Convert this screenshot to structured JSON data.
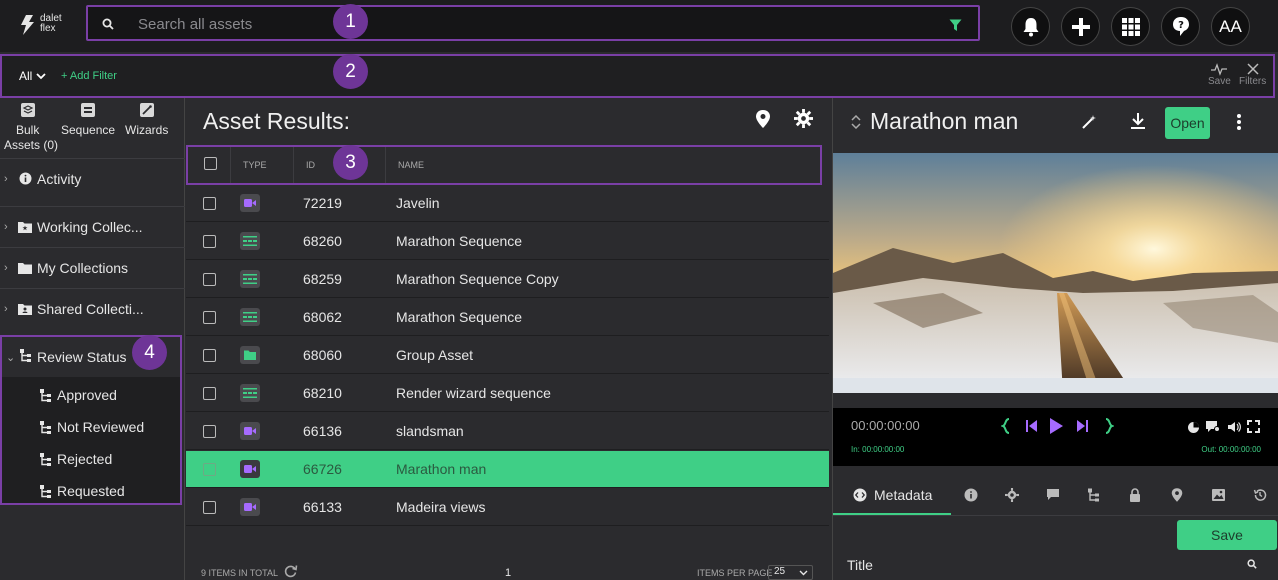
{
  "app": {
    "logo_line1": "dalet",
    "logo_line2": "flex"
  },
  "search": {
    "placeholder": "Search all assets"
  },
  "top_actions": {
    "avatar_initials": "AA"
  },
  "callouts": [
    "1",
    "2",
    "3",
    "4"
  ],
  "filterbar": {
    "scope": "All",
    "add_filter": "+ Add Filter",
    "save_label": "Save",
    "filters_label": "Filters"
  },
  "sidebar": {
    "tools": [
      {
        "label": "Bulk"
      },
      {
        "label": "Sequence"
      },
      {
        "label": "Wizards"
      }
    ],
    "bulk_sub": "Assets (0)",
    "items": [
      {
        "label": "Activity"
      },
      {
        "label": "Working Collec..."
      },
      {
        "label": "My Collections"
      },
      {
        "label": "Shared Collecti..."
      }
    ],
    "review": {
      "label": "Review Status",
      "children": [
        "Approved",
        "Not Reviewed",
        "Rejected",
        "Requested"
      ]
    }
  },
  "results": {
    "title": "Asset Results:",
    "columns": {
      "type": "TYPE",
      "id": "ID",
      "name": "NAME"
    },
    "rows": [
      {
        "kind": "video",
        "id": "72219",
        "name": "Javelin"
      },
      {
        "kind": "sequence",
        "id": "68260",
        "name": "Marathon Sequence"
      },
      {
        "kind": "sequence",
        "id": "68259",
        "name": "Marathon Sequence Copy"
      },
      {
        "kind": "sequence",
        "id": "68062",
        "name": "Marathon Sequence"
      },
      {
        "kind": "group",
        "id": "68060",
        "name": "Group Asset"
      },
      {
        "kind": "sequence",
        "id": "68210",
        "name": "Render wizard sequence"
      },
      {
        "kind": "video",
        "id": "66136",
        "name": "slandsman"
      },
      {
        "kind": "video",
        "id": "66726",
        "name": "Marathon man",
        "selected": true
      },
      {
        "kind": "video",
        "id": "66133",
        "name": "Madeira views"
      }
    ],
    "footer": {
      "total": "9 ITEMS IN TOTAL",
      "page": "1",
      "per_page_label": "ITEMS PER PAGE",
      "per_page": "25"
    }
  },
  "preview": {
    "title": "Marathon man",
    "open_label": "Open",
    "timecode": "00:00:00:00",
    "in_mark": "In: 00:00:00:00",
    "out_mark": "Out: 00:00:00:00",
    "tab_metadata": "Metadata",
    "save_label": "Save",
    "field_title": "Title"
  },
  "colors": {
    "accent": "#3fcf86",
    "callout": "#6e3597",
    "highlight_border": "#7a3fa6",
    "icon_purple": "#a66bff"
  }
}
